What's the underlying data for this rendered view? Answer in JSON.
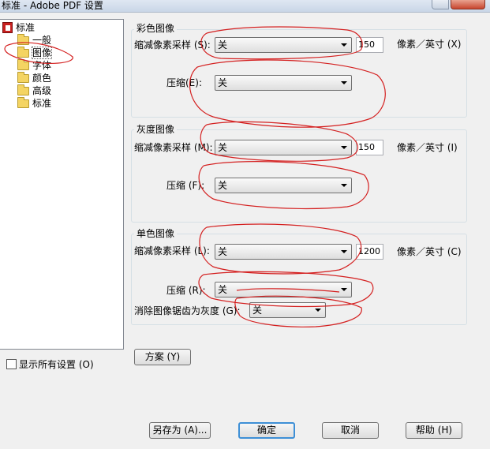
{
  "window": {
    "title": "标准 - Adobe PDF 设置"
  },
  "tree": {
    "root": "标准",
    "items": [
      "一般",
      "图像",
      "字体",
      "颜色",
      "高级",
      "标准"
    ],
    "selected_index": 1
  },
  "show_all_settings": {
    "label": "显示所有设置 (O)",
    "checked": false
  },
  "color_images": {
    "title": "彩色图像",
    "downsample_label": "缩减像素采样 (S):",
    "downsample_value": "关",
    "resolution_value": "150",
    "unit_label": "像素／英寸 (X)",
    "compression_label": "压缩(E):",
    "compression_value": "关"
  },
  "gray_images": {
    "title": "灰度图像",
    "downsample_label": "缩减像素采样 (M):",
    "downsample_value": "关",
    "resolution_value": "150",
    "unit_label": "像素／英寸 (I)",
    "compression_label": "压缩 (F):",
    "compression_value": "关"
  },
  "mono_images": {
    "title": "单色图像",
    "downsample_label": "缩减像素采样 (L):",
    "downsample_value": "关",
    "resolution_value": "1200",
    "unit_label": "像素／英寸 (C)",
    "compression_label": "压缩 (R):",
    "compression_value": "关",
    "antialias_label": "消除图像锯齿为灰度 (G):",
    "antialias_value": "关"
  },
  "buttons": {
    "scheme": "方案 (Y)",
    "save_as": "另存为 (A)...",
    "ok": "确定",
    "cancel": "取消",
    "help": "帮助 (H)"
  },
  "colors": {
    "annotation_red": "#d42020",
    "focus_blue": "#3d8fd6"
  }
}
